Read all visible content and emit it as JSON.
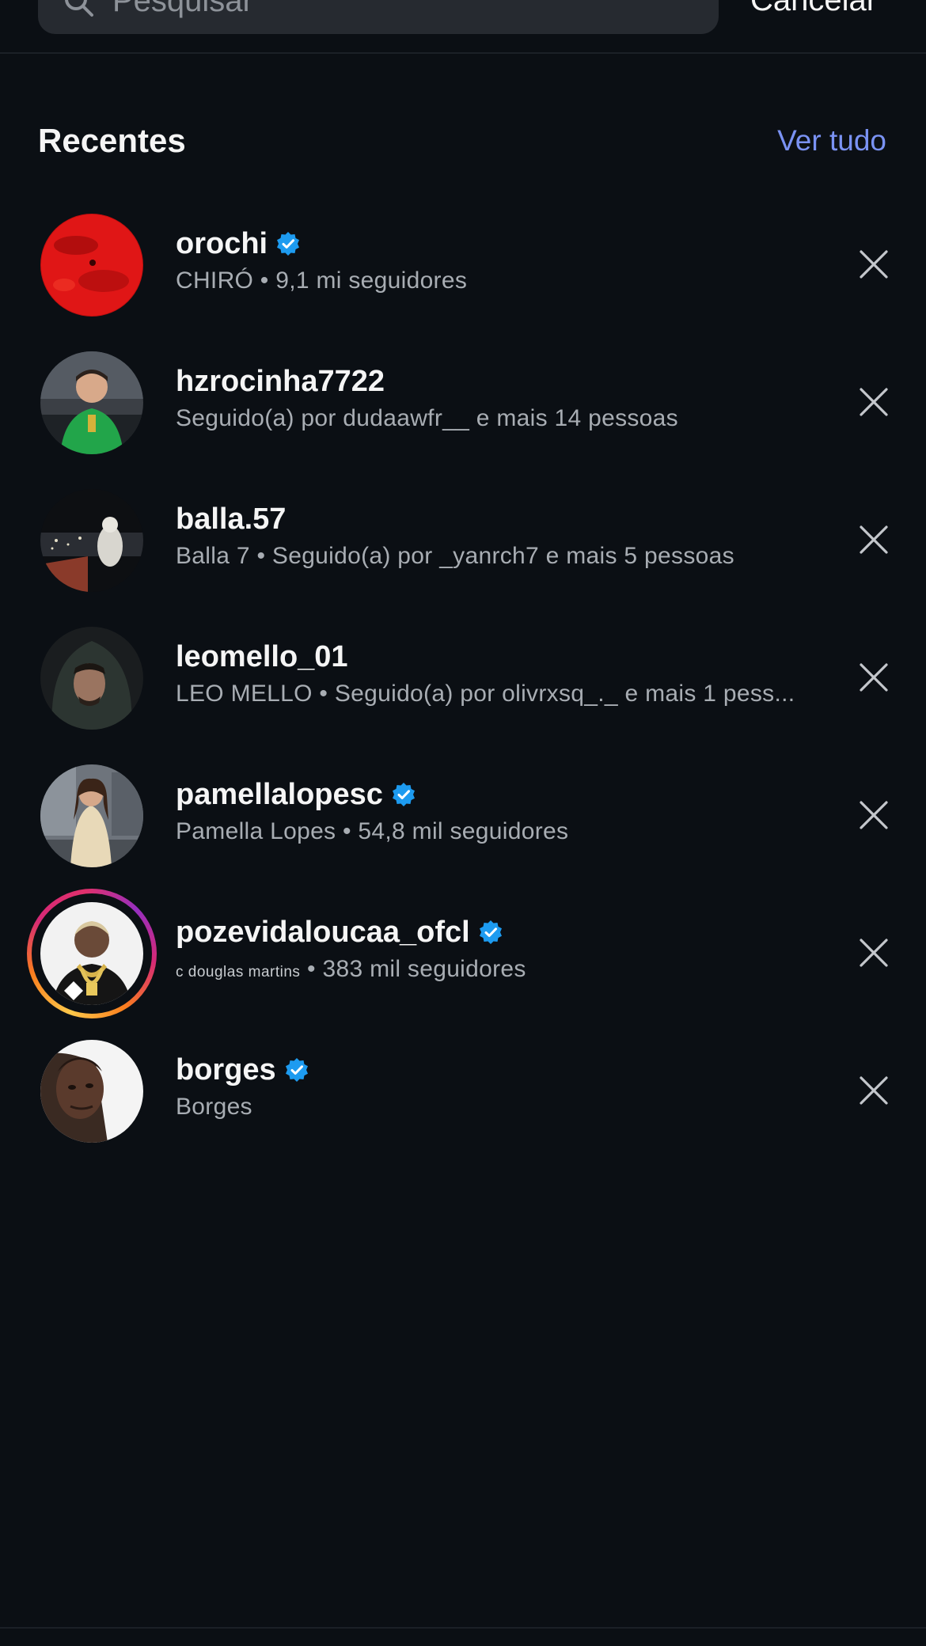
{
  "search": {
    "placeholder": "Pesquisar",
    "cancel_label": "Cancelar"
  },
  "recent": {
    "title": "Recentes",
    "see_all_label": "Ver tudo"
  },
  "results": [
    {
      "username": "orochi",
      "verified": true,
      "subtitle_name": "CHIRÓ",
      "subtitle_rest": " • 9,1 mi seguidores",
      "avatar_icon": "red-planet-avatar",
      "has_story": false
    },
    {
      "username": "hzrocinha7722",
      "verified": false,
      "subtitle_name": "",
      "subtitle_rest": "Seguido(a) por dudaawfr__ e mais 14 pessoas",
      "avatar_icon": "person-green-shirt-avatar",
      "has_story": false
    },
    {
      "username": "balla.57",
      "verified": false,
      "subtitle_name": "",
      "subtitle_rest": "Balla 7 • Seguido(a) por _yanrch7 e mais 5 pessoas",
      "avatar_icon": "night-city-avatar",
      "has_story": false
    },
    {
      "username": "leomello_01",
      "verified": false,
      "subtitle_name": "",
      "subtitle_rest": "LEO MELLO • Seguido(a) por olivrxsq_._ e mais 1 pess...",
      "avatar_icon": "hooded-person-avatar",
      "has_story": false
    },
    {
      "username": "pamellalopesc",
      "verified": true,
      "subtitle_name": "",
      "subtitle_rest": "Pamella Lopes • 54,8 mil seguidores",
      "avatar_icon": "woman-street-avatar",
      "has_story": false
    },
    {
      "username": "pozevidaloucaa_ofcl",
      "verified": true,
      "subtitle_name": "c douglas martins",
      "subtitle_rest": " • 383 mil seguidores",
      "avatar_icon": "man-gold-chains-avatar",
      "has_story": true
    },
    {
      "username": "borges",
      "verified": true,
      "subtitle_name": "",
      "subtitle_rest": "Borges",
      "avatar_icon": "man-portrait-avatar",
      "has_story": false
    }
  ],
  "colors": {
    "background": "#0b0f14",
    "link": "#7a92f3",
    "verified": "#1d9bf0",
    "secondary_text": "#a8adb3"
  }
}
